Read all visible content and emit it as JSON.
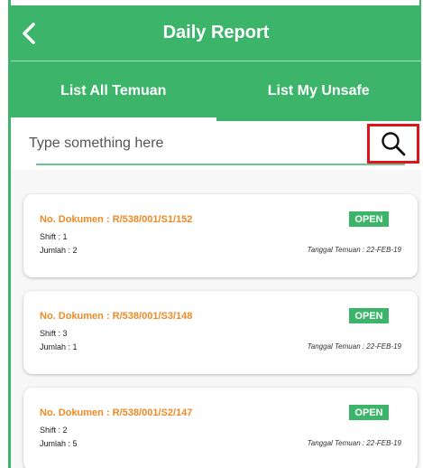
{
  "header": {
    "title": "Daily Report",
    "back_icon": "chevron-left-icon"
  },
  "tabs": [
    {
      "label": "List All Temuan",
      "active": true
    },
    {
      "label": "List My Unsafe",
      "active": false
    }
  ],
  "search": {
    "placeholder": "Type something here",
    "value": "",
    "icon": "search-icon"
  },
  "reports": [
    {
      "doc": "No. Dokumen : R/538/001/S1/152",
      "shift": "Shift : 1",
      "jumlah": "Jumlah : 2",
      "status": "OPEN",
      "tanggal": "Tanggal Temuan : 22-FEB-19"
    },
    {
      "doc": "No. Dokumen : R/538/001/S3/148",
      "shift": "Shift : 3",
      "jumlah": "Jumlah : 1",
      "status": "OPEN",
      "tanggal": "Tanggal Temuan : 22-FEB-19"
    },
    {
      "doc": "No. Dokumen : R/538/001/S2/147",
      "shift": "Shift : 2",
      "jumlah": "Jumlah : 5",
      "status": "OPEN",
      "tanggal": "Tanggal Temuan : 22-FEB-19"
    }
  ],
  "colors": {
    "primary": "#3cb56a",
    "accent": "#f08a24",
    "highlight": "#e0151b"
  }
}
